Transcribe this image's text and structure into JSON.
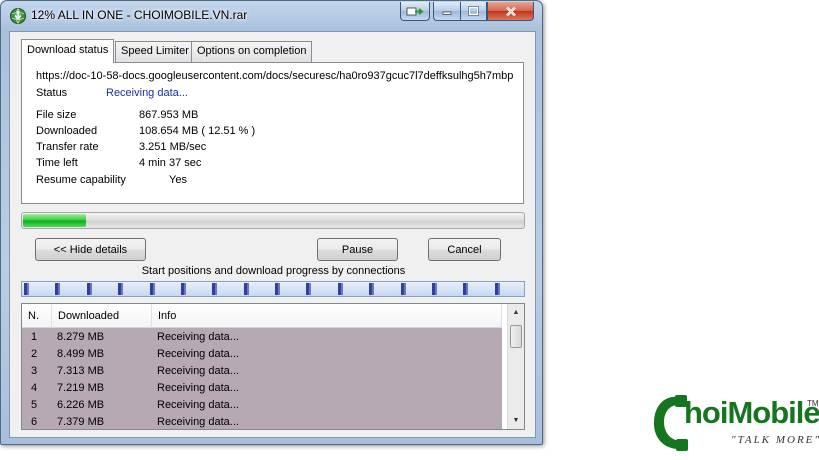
{
  "window": {
    "title": "12% ALL IN ONE - CHOIMOBILE.VN.rar"
  },
  "tabs": [
    {
      "label": "Download status",
      "active": true
    },
    {
      "label": "Speed Limiter",
      "active": false
    },
    {
      "label": "Options on completion",
      "active": false
    }
  ],
  "download": {
    "url": "https://doc-10-58-docs.googleusercontent.com/docs/securesc/ha0ro937gcuc7l7deffksulhg5h7mbp",
    "status_label": "Status",
    "status_value": "Receiving data...",
    "file_size_label": "File size",
    "file_size_value": "867.953  MB",
    "downloaded_label": "Downloaded",
    "downloaded_value": "108.654  MB  ( 12.51 % )",
    "transfer_rate_label": "Transfer rate",
    "transfer_rate_value": "3.251  MB/sec",
    "time_left_label": "Time left",
    "time_left_value": "4 min 37 sec",
    "resume_label": "Resume capability",
    "resume_value": "Yes",
    "progress_percent": 12.51
  },
  "buttons": {
    "hide_details": "<< Hide details",
    "pause": "Pause",
    "cancel": "Cancel"
  },
  "connections": {
    "caption": "Start positions and download progress by connections",
    "count": 16
  },
  "list": {
    "columns": [
      "N.",
      "Downloaded",
      "Info"
    ],
    "rows": [
      {
        "n": "1",
        "downloaded": "8.279  MB",
        "info": "Receiving data..."
      },
      {
        "n": "2",
        "downloaded": "8.499  MB",
        "info": "Receiving data..."
      },
      {
        "n": "3",
        "downloaded": "7.313  MB",
        "info": "Receiving data..."
      },
      {
        "n": "4",
        "downloaded": "7.219  MB",
        "info": "Receiving data..."
      },
      {
        "n": "5",
        "downloaded": "6.226  MB",
        "info": "Receiving data..."
      },
      {
        "n": "6",
        "downloaded": "7.379  MB",
        "info": "Receiving data..."
      }
    ]
  },
  "logo": {
    "name": "hoiMobile",
    "tm": "TM",
    "slogan": "\"TALK MORE\""
  },
  "colors": {
    "progress_green": "#06b025",
    "status_blue": "#1a2fa8",
    "list_row_bg": "#b6a9b4",
    "logo_green": "#16751f"
  }
}
